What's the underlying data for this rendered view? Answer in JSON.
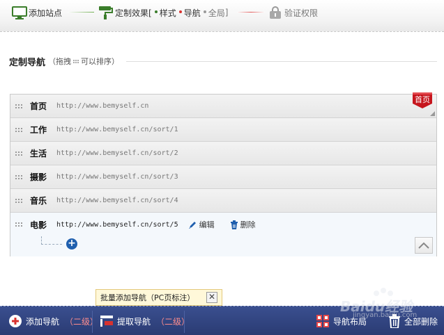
{
  "steps": {
    "step1": {
      "label": "添加站点"
    },
    "step2": {
      "label": "定制效果[",
      "subs": [
        "样式",
        "导航",
        "全局"
      ],
      "close": "]"
    },
    "step3": {
      "label": "验证权限"
    }
  },
  "section": {
    "title": "定制导航",
    "hint_open": "（拖拽",
    "hint_close": "可以排序）"
  },
  "nav_items": [
    {
      "name": "首页",
      "url": "http://www.bemyself.cn"
    },
    {
      "name": "工作",
      "url": "http://www.bemyself.cn/sort/1"
    },
    {
      "name": "生活",
      "url": "http://www.bemyself.cn/sort/2"
    },
    {
      "name": "摄影",
      "url": "http://www.bemyself.cn/sort/3"
    },
    {
      "name": "音乐",
      "url": "http://www.bemyself.cn/sort/4"
    },
    {
      "name": "电影",
      "url": "http://www.bemyself.cn/sort/5"
    }
  ],
  "row_actions": {
    "edit": "编辑",
    "delete": "删除"
  },
  "home_badge": "首页",
  "tooltip": {
    "text": "批量添加导航（PC页标注）",
    "close": "✕"
  },
  "toolbar": {
    "add_nav": "添加导航",
    "add_nav_level": "（二级）",
    "extract_nav": "提取导航",
    "extract_nav_level": "（二级）",
    "layout": "导航布局",
    "delete_all": "全部删除"
  },
  "watermark": {
    "text": "Baidu经验",
    "sub": "jingyan.baidu.com"
  },
  "colors": {
    "active_green": "#3a7d2a",
    "inactive_red": "#e35a5a",
    "home_badge": "#c6161e",
    "toolbar_bg": "#2f4178",
    "level_text": "#ff8d8d"
  }
}
